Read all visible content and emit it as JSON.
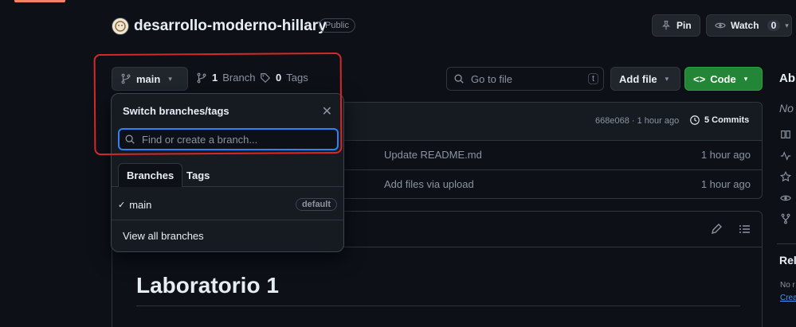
{
  "repo": {
    "name": "desarrollo-moderno-hillary",
    "visibility": "Public"
  },
  "header_actions": {
    "pin_label": "Pin",
    "watch_label": "Watch",
    "watch_count": "0"
  },
  "toolbar": {
    "branch_label": "main",
    "branch_count": "1",
    "branch_text": "Branch",
    "tag_count": "0",
    "tag_text": "Tags",
    "go_to_file_placeholder": "Go to file",
    "go_to_file_shortcut": "t",
    "add_file_label": "Add file",
    "code_label": "Code"
  },
  "commit_bar": {
    "hash_time": "668e068 · 1 hour ago",
    "commits_label": "5 Commits"
  },
  "files": [
    {
      "message": "Update README.md",
      "time": "1 hour ago"
    },
    {
      "message": "Add files via upload",
      "time": "1 hour ago"
    }
  ],
  "branch_dropdown": {
    "title": "Switch branches/tags",
    "search_placeholder": "Find or create a branch...",
    "tabs": [
      "Branches",
      "Tags"
    ],
    "branches": [
      {
        "name": "main",
        "badge": "default"
      }
    ],
    "view_all": "View all branches"
  },
  "readme": {
    "heading": "Laboratorio 1"
  },
  "sidebar": {
    "about_partial": "Ab",
    "no_desc_partial": "No",
    "releases_partial": "Rel",
    "no_releases_partial": "No r",
    "create_partial": "Crea"
  }
}
